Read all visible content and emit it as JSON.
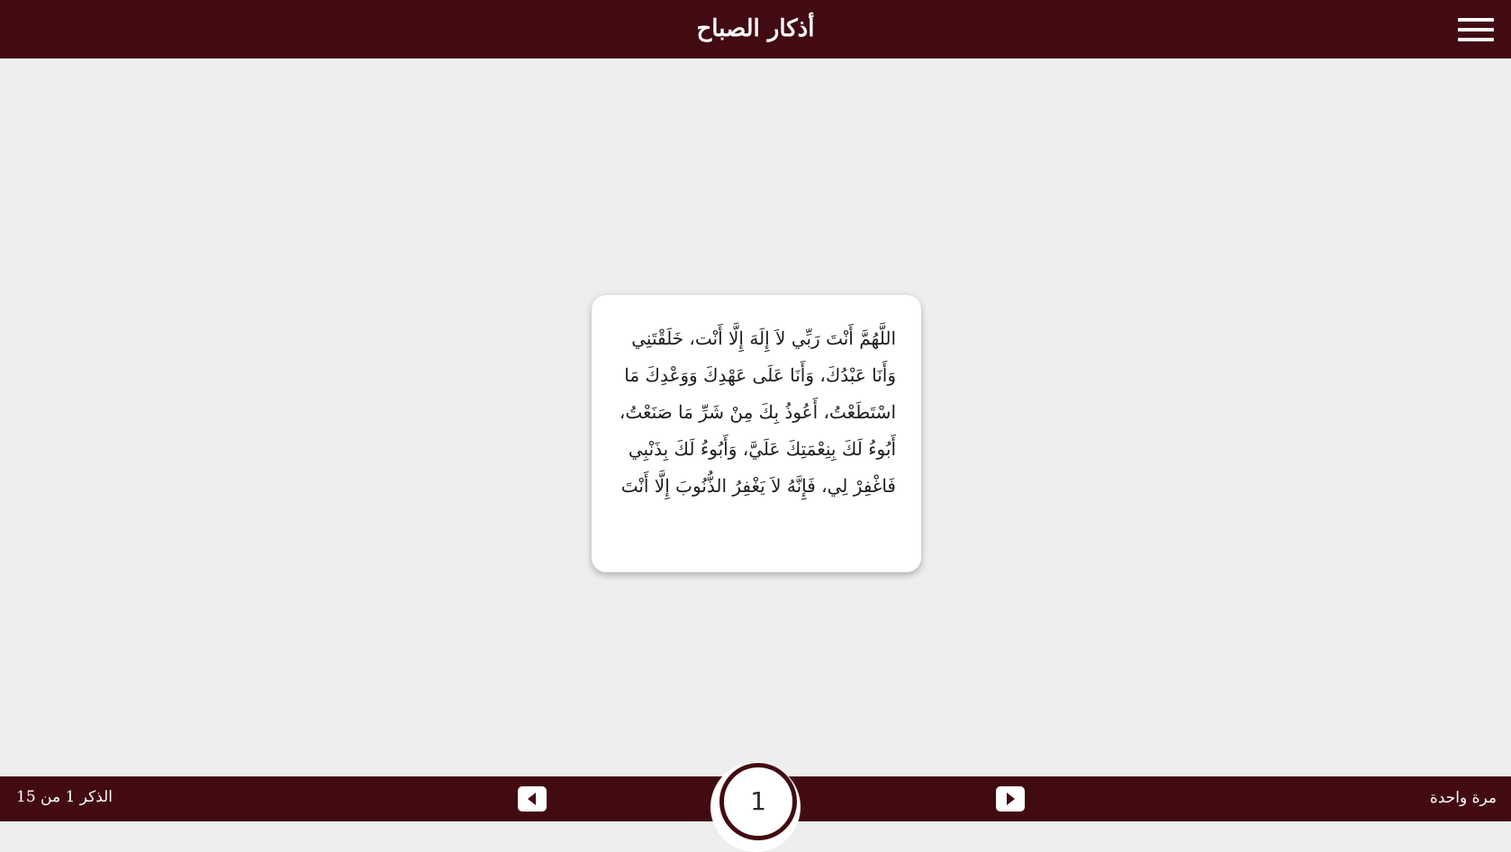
{
  "header": {
    "title": "أذكار الصباح",
    "menu_icon": "hamburger-menu-icon"
  },
  "card": {
    "text": "اللَّهُمَّ أَنْتَ رَبِّي لاَ إِلَهَ إِلَّا أَنْت، خَلَقْتَنِي وَأَنَا عَبْدُكَ، وَأَنَا عَلَى عَهْدِكَ وَوَعْدِكَ مَا اسْتَطَعْتُ، أَعُوذُ بِكَ مِنْ شَرِّ مَا صَنَعْتُ، أَبُوءُ لَكَ بِنِعْمَتِكَ عَلَيَّ، وَأَبُوءُ لَكَ بِذَنْبِي فَاغْفِرْ لِي، فَإِنَّهُ لاَ يَغْفِرُ الذُّنُوبَ إِلَّا أَنْتَ"
  },
  "footer": {
    "progress_label": "الذكر 1 من 15",
    "repeat_label": "مرة واحدة",
    "prev_icon": "caret-left-icon",
    "next_icon": "caret-right-icon",
    "counter_value": "1"
  },
  "colors": {
    "primary": "#420b12",
    "background": "#eeeeee",
    "card": "#ffffff"
  }
}
